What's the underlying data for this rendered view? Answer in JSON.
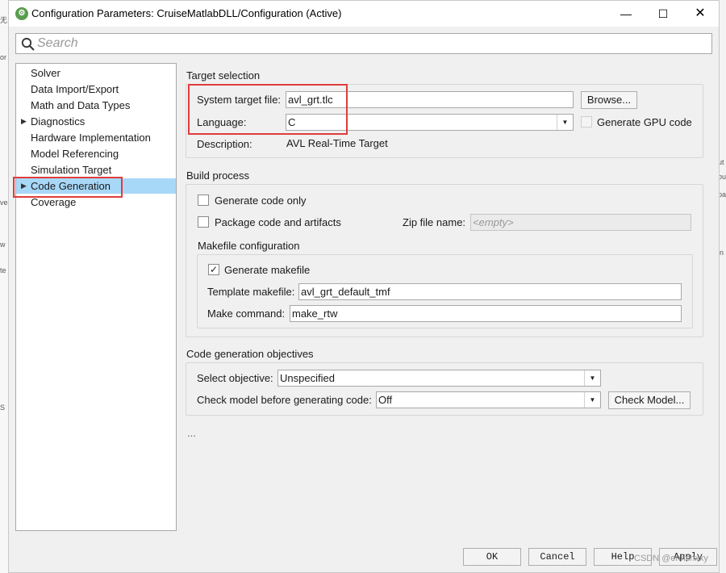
{
  "window": {
    "title": "Configuration Parameters: CruiseMatlabDLL/Configuration (Active)",
    "minimize_glyph": "—",
    "maximize_glyph": "☐",
    "close_glyph": "✕"
  },
  "search": {
    "placeholder": "Search"
  },
  "sidebar": {
    "items": [
      {
        "label": "Solver",
        "expandable": false,
        "selected": false
      },
      {
        "label": "Data Import/Export",
        "expandable": false,
        "selected": false
      },
      {
        "label": "Math and Data Types",
        "expandable": false,
        "selected": false
      },
      {
        "label": "Diagnostics",
        "expandable": true,
        "selected": false
      },
      {
        "label": "Hardware Implementation",
        "expandable": false,
        "selected": false
      },
      {
        "label": "Model Referencing",
        "expandable": false,
        "selected": false
      },
      {
        "label": "Simulation Target",
        "expandable": false,
        "selected": false
      },
      {
        "label": "Code Generation",
        "expandable": true,
        "selected": true
      },
      {
        "label": "Coverage",
        "expandable": false,
        "selected": false
      }
    ]
  },
  "target_selection": {
    "title": "Target selection",
    "system_target_file_label": "System target file:",
    "system_target_file_value": "avl_grt.tlc",
    "browse_label": "Browse...",
    "language_label": "Language:",
    "language_value": "C",
    "gpu_label": "Generate GPU code",
    "gpu_checked": false,
    "description_label": "Description:",
    "description_value": "AVL Real-Time Target"
  },
  "build_process": {
    "title": "Build process",
    "generate_code_only_label": "Generate code only",
    "generate_code_only_checked": false,
    "package_label": "Package code and artifacts",
    "package_checked": false,
    "zip_label": "Zip file name:",
    "zip_placeholder": "<empty>",
    "makefile": {
      "title": "Makefile configuration",
      "generate_makefile_label": "Generate makefile",
      "generate_makefile_checked": true,
      "template_label": "Template makefile:",
      "template_value": "avl_grt_default_tmf",
      "make_command_label": "Make command:",
      "make_command_value": "make_rtw"
    }
  },
  "objectives": {
    "title": "Code generation objectives",
    "select_label": "Select objective:",
    "select_value": "Unspecified",
    "check_label": "Check model before generating code:",
    "check_value": "Off",
    "check_button_label": "Check Model..."
  },
  "ellipsis": "...",
  "footer": {
    "ok_label": "OK",
    "cancel_label": "Cancel",
    "help_label": "Help",
    "apply_label": "Apply",
    "watermark": "CSDN @enrichxxy"
  },
  "colors": {
    "selection": "#a8d8f8",
    "highlight_box": "#e03c3c"
  }
}
